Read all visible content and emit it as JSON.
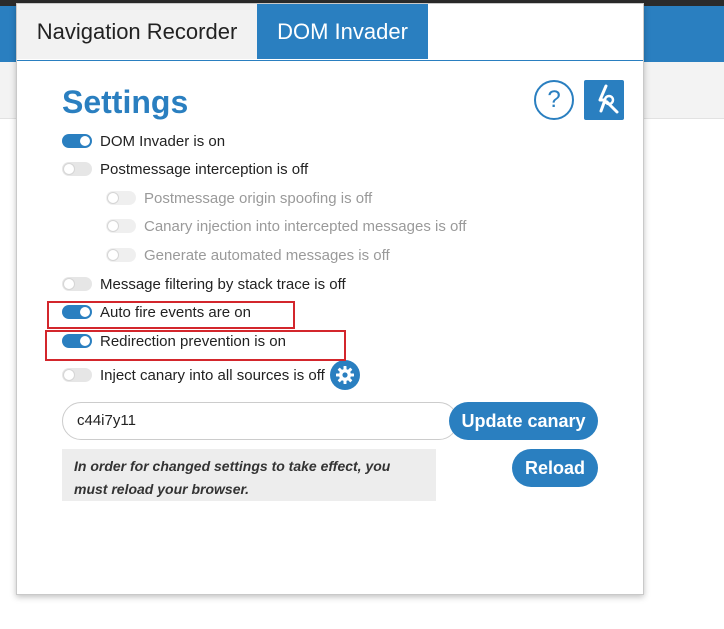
{
  "tabs": [
    {
      "label": "Navigation Recorder",
      "active": false
    },
    {
      "label": "DOM Invader",
      "active": true
    }
  ],
  "settings_title": "Settings",
  "help_label": "?",
  "toggles": {
    "dom_invader": {
      "label": "DOM Invader is on",
      "state": "on"
    },
    "postmessage": {
      "label": "Postmessage interception is off",
      "state": "off"
    },
    "origin_spoofing": {
      "label": "Postmessage origin spoofing is off",
      "state": "off",
      "disabled": true
    },
    "canary_injection": {
      "label": "Canary injection into intercepted messages is off",
      "state": "off",
      "disabled": true
    },
    "generate_messages": {
      "label": "Generate automated messages is off",
      "state": "off",
      "disabled": true
    },
    "stack_filter": {
      "label": "Message filtering by stack trace is off",
      "state": "off"
    },
    "auto_fire": {
      "label": "Auto fire events are on",
      "state": "on"
    },
    "redirection": {
      "label": "Redirection prevention is on",
      "state": "on"
    },
    "inject_canary": {
      "label": "Inject canary into all sources is off",
      "state": "off"
    }
  },
  "canary": {
    "value": "c44i7y11"
  },
  "buttons": {
    "update": "Update canary",
    "reload": "Reload"
  },
  "notice": "In order for changed settings to take effect, you must reload your browser.",
  "colors": {
    "accent": "#2a7fc0",
    "highlight": "#d3262c"
  },
  "icons": {
    "help": "question-mark-icon",
    "tools": "wrench-tool-icon",
    "gear": "gear-icon"
  }
}
